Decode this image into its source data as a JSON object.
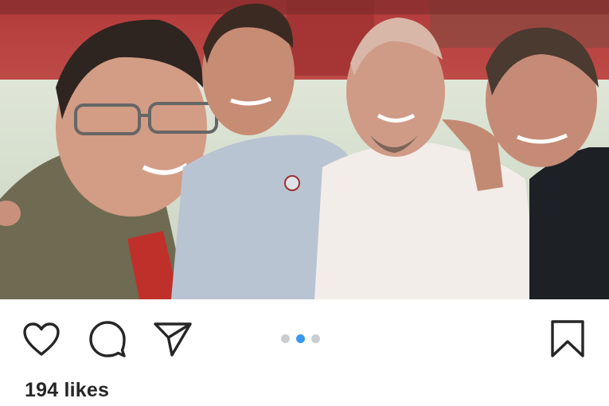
{
  "post": {
    "photo": {
      "alt_subject": "selfie-at-stadium",
      "people_count": 4
    },
    "actions": {
      "like_icon": "heart-outline-icon",
      "comment_icon": "speech-bubble-icon",
      "share_icon": "paper-plane-icon",
      "save_icon": "bookmark-outline-icon"
    },
    "carousel": {
      "total": 3,
      "active_index": 1
    },
    "likes_text": "194 likes",
    "colors": {
      "icon": "#262626",
      "dot_active": "#3897f0",
      "dot_inactive": "#c9ccd1",
      "text": "#262626"
    }
  }
}
